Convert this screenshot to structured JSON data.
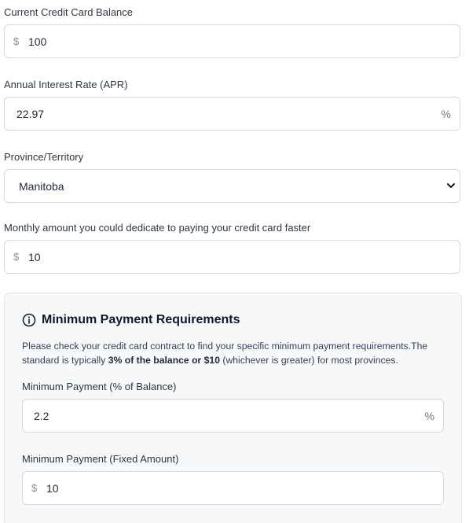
{
  "balance": {
    "label": "Current Credit Card Balance",
    "prefix": "$",
    "value": "100"
  },
  "apr": {
    "label": "Annual Interest Rate (APR)",
    "value": "22.97",
    "suffix": "%"
  },
  "province": {
    "label": "Province/Territory",
    "selected": "Manitoba",
    "icon": "chevron-down-icon"
  },
  "monthly": {
    "label": "Monthly amount you could dedicate to paying your credit card faster",
    "prefix": "$",
    "value": "10"
  },
  "min_req": {
    "icon": "info-icon",
    "title": "Minimum Payment Requirements",
    "text_before": "Please check your credit card contract to find your specific minimum payment requirements.The standard is typically ",
    "text_bold1": "3% of the balance or $10",
    "text_after": " (whichever is greater) for most provinces.",
    "percent": {
      "label": "Minimum Payment (% of Balance)",
      "value": "2.2",
      "suffix": "%"
    },
    "fixed": {
      "label": "Minimum Payment (Fixed Amount)",
      "prefix": "$",
      "value": "10"
    }
  }
}
